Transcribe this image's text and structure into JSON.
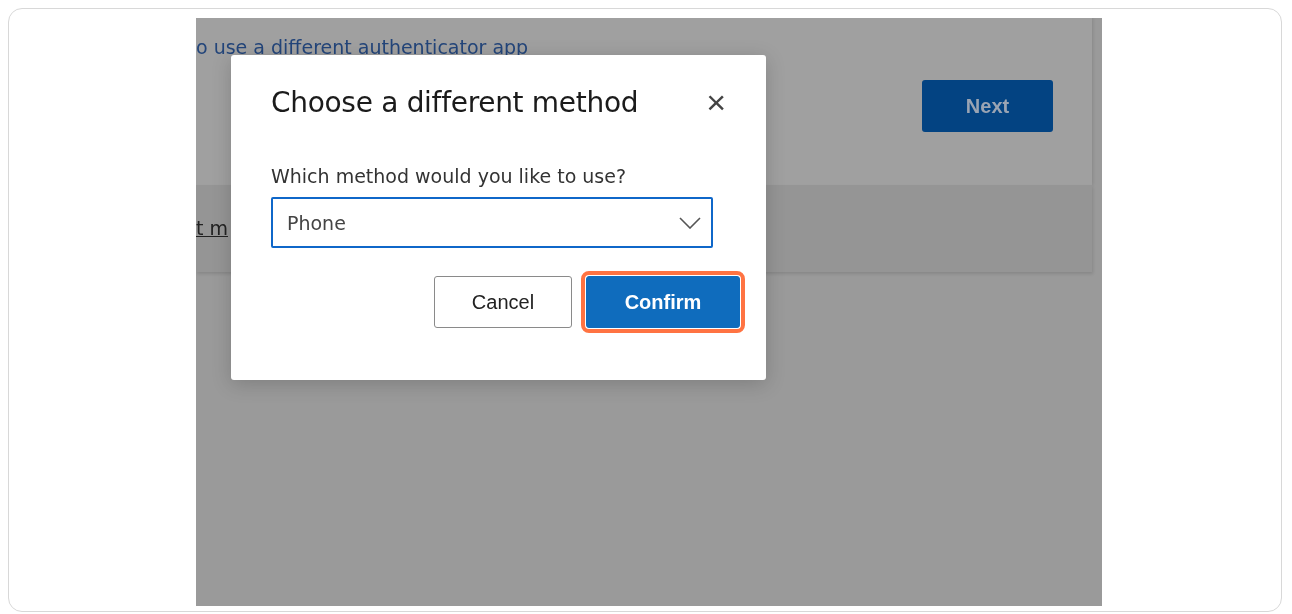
{
  "background_page": {
    "link": "o use a different authenticator app",
    "next_button": "Next",
    "footer_link": "t m"
  },
  "dialog": {
    "title": "Choose a different method",
    "close": "×",
    "field_label": "Which method would you like to use?",
    "select": {
      "value": "Phone",
      "focused": true
    },
    "buttons": [
      {
        "label": "Cancel",
        "kind": "secondary",
        "highlighted": false
      },
      {
        "label": "Confirm",
        "kind": "primary",
        "highlighted": true
      }
    ]
  }
}
